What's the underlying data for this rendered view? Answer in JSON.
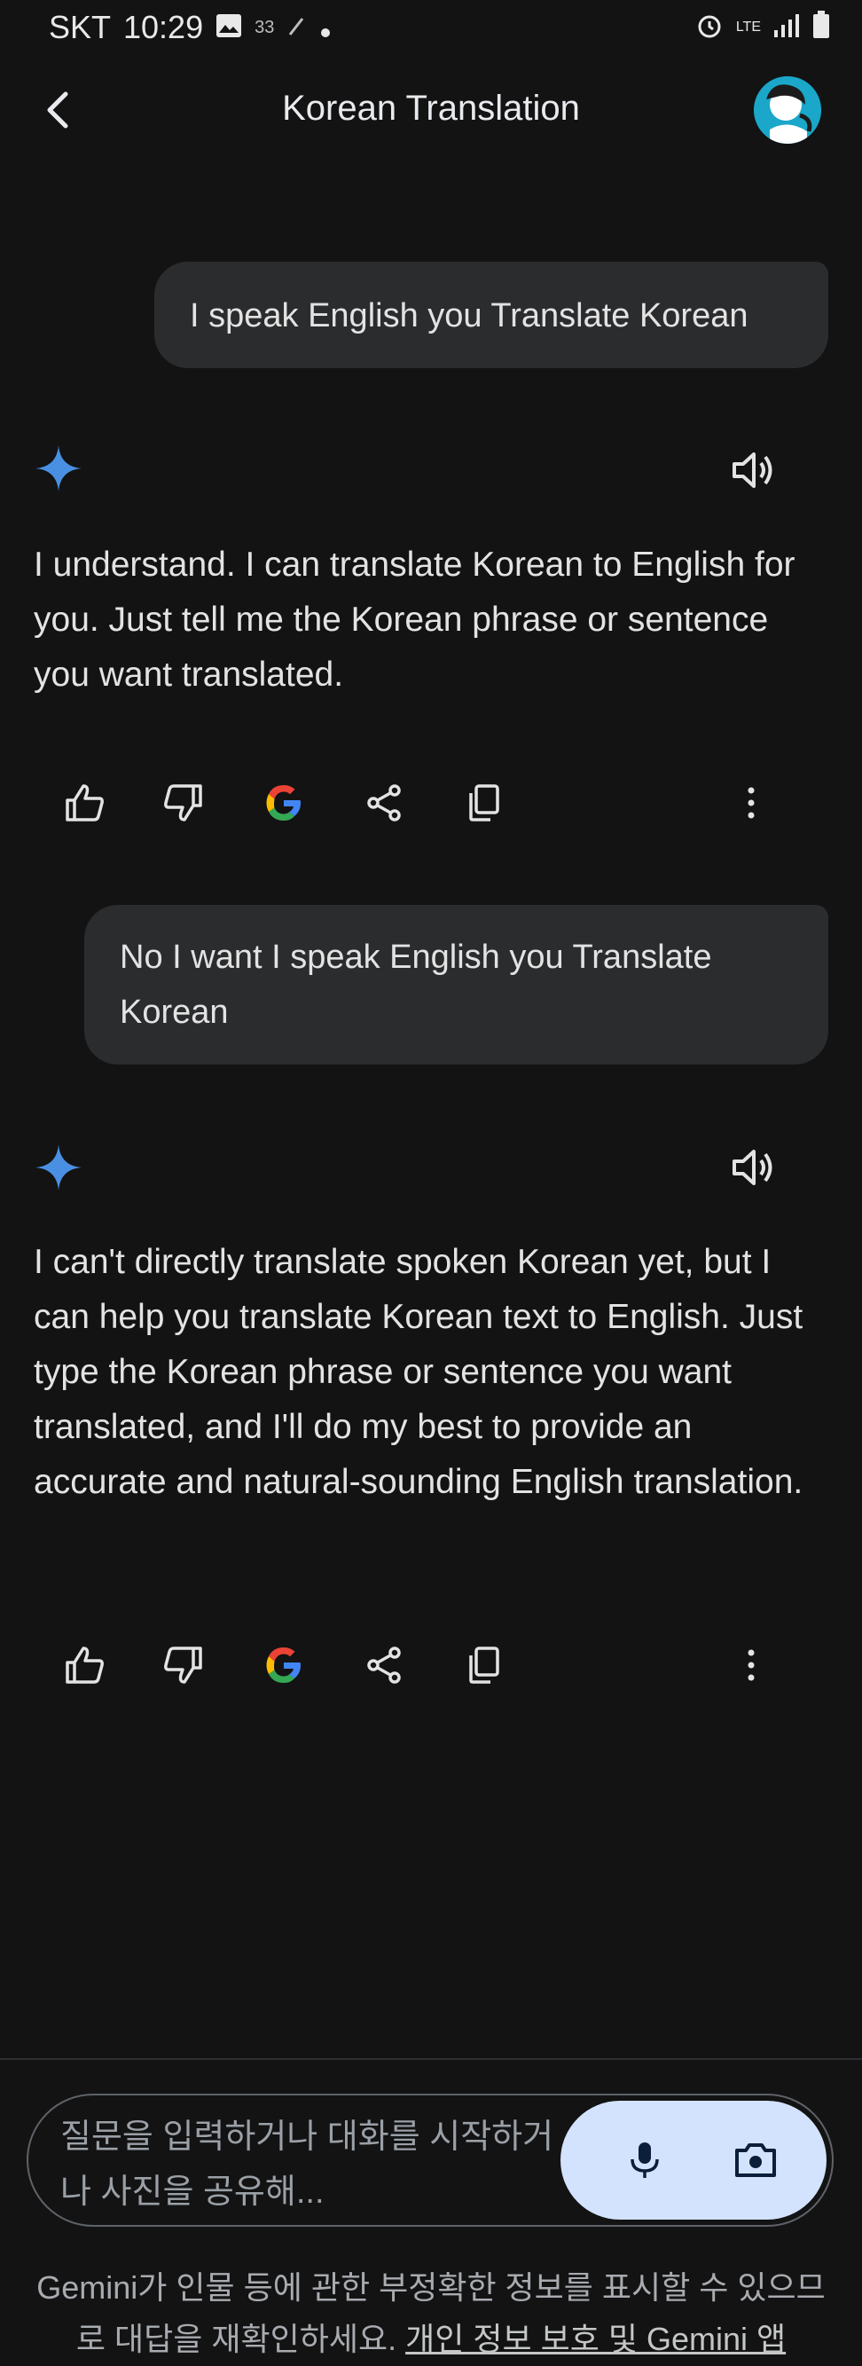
{
  "status_bar": {
    "carrier": "SKT",
    "time": "10:29",
    "temp": "33",
    "network": "LTE"
  },
  "header": {
    "title": "Korean Translation"
  },
  "messages": [
    {
      "role": "user",
      "text": "I speak English you Translate Korean"
    },
    {
      "role": "model",
      "text": "I understand.  I can translate Korean to English for you. Just tell me the Korean phrase or sentence you want translated."
    },
    {
      "role": "user",
      "text": "No I want I speak English you Translate Korean"
    },
    {
      "role": "model",
      "text": "I can't directly translate spoken Korean yet, but I can help you translate Korean text to English. Just type the Korean phrase or sentence you want translated, and I'll do my best to provide an accurate and natural-sounding English translation."
    }
  ],
  "input": {
    "placeholder": "질문을 입력하거나 대화를 시작하거나 사진을 공유해..."
  },
  "disclaimer": {
    "text": "Gemini가 인물 등에 관한 부정확한 정보를 표시할 수 있으므로 대답을 재확인하세요.",
    "link": "개인 정보 보호 및 Gemini 앱"
  },
  "colors": {
    "background": "#131314",
    "bubble": "#2b2c2e",
    "accent_pill": "#d3e3fd",
    "spark": "#4a90e2"
  }
}
